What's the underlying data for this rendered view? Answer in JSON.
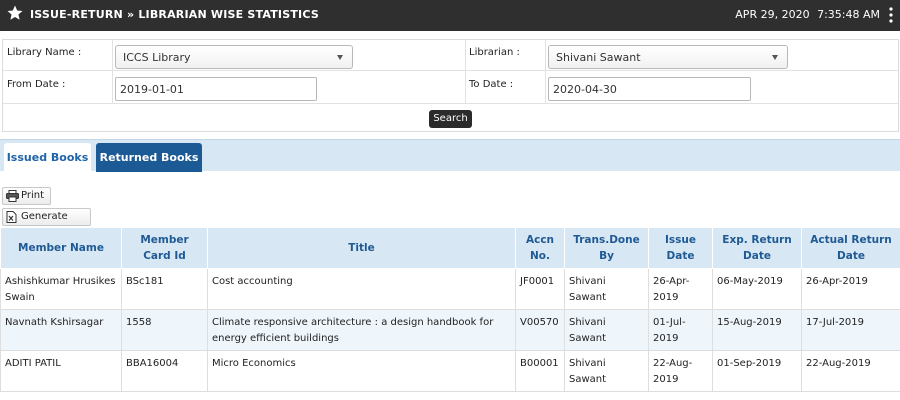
{
  "header": {
    "title": "ISSUE-RETURN » LIBRARIAN WISE STATISTICS",
    "date": "APR 29, 2020",
    "time": "7:35:48 AM"
  },
  "filters": {
    "library_label": "Library Name :",
    "library_value": "ICCS Library",
    "librarian_label": "Librarian :",
    "librarian_value": "Shivani Sawant",
    "from_label": "From Date :",
    "from_value": "2019-01-01",
    "to_label": "To Date :",
    "to_value": "2020-04-30",
    "search_label": "Search"
  },
  "tabs": [
    {
      "label": "Issued Books",
      "active": false
    },
    {
      "label": "Returned Books",
      "active": true
    }
  ],
  "toolbar": {
    "print_label": "Print",
    "excel_label": "Generate Excel"
  },
  "table": {
    "columns": [
      "Member Name",
      "Member Card Id",
      "Title",
      "Accn No.",
      "Trans.Done By",
      "Issue Date",
      "Exp. Return Date",
      "Actual Return Date"
    ],
    "rows": [
      [
        "Ashishkumar Hrusikes Swain",
        "BSc181",
        "Cost accounting",
        "JF0001",
        "Shivani Sawant",
        "26-Apr-2019",
        "06-May-2019",
        "26-Apr-2019"
      ],
      [
        "Navnath Kshirsagar",
        "1558",
        "Climate responsive architecture : a design handbook for energy efficient buildings",
        "V00570",
        "Shivani Sawant",
        "01-Jul-2019",
        "15-Aug-2019",
        "17-Jul-2019"
      ],
      [
        "ADITI PATIL",
        "BBA16004",
        "Micro Economics",
        "B00001",
        "Shivani Sawant",
        "22-Aug-2019",
        "01-Sep-2019",
        "22-Aug-2019"
      ]
    ]
  },
  "colors": {
    "header_bg": "#2f2f2f",
    "tab_active_bg": "#1c5a95",
    "table_header_bg": "#d8e7f4",
    "table_header_text": "#1f5a94"
  }
}
